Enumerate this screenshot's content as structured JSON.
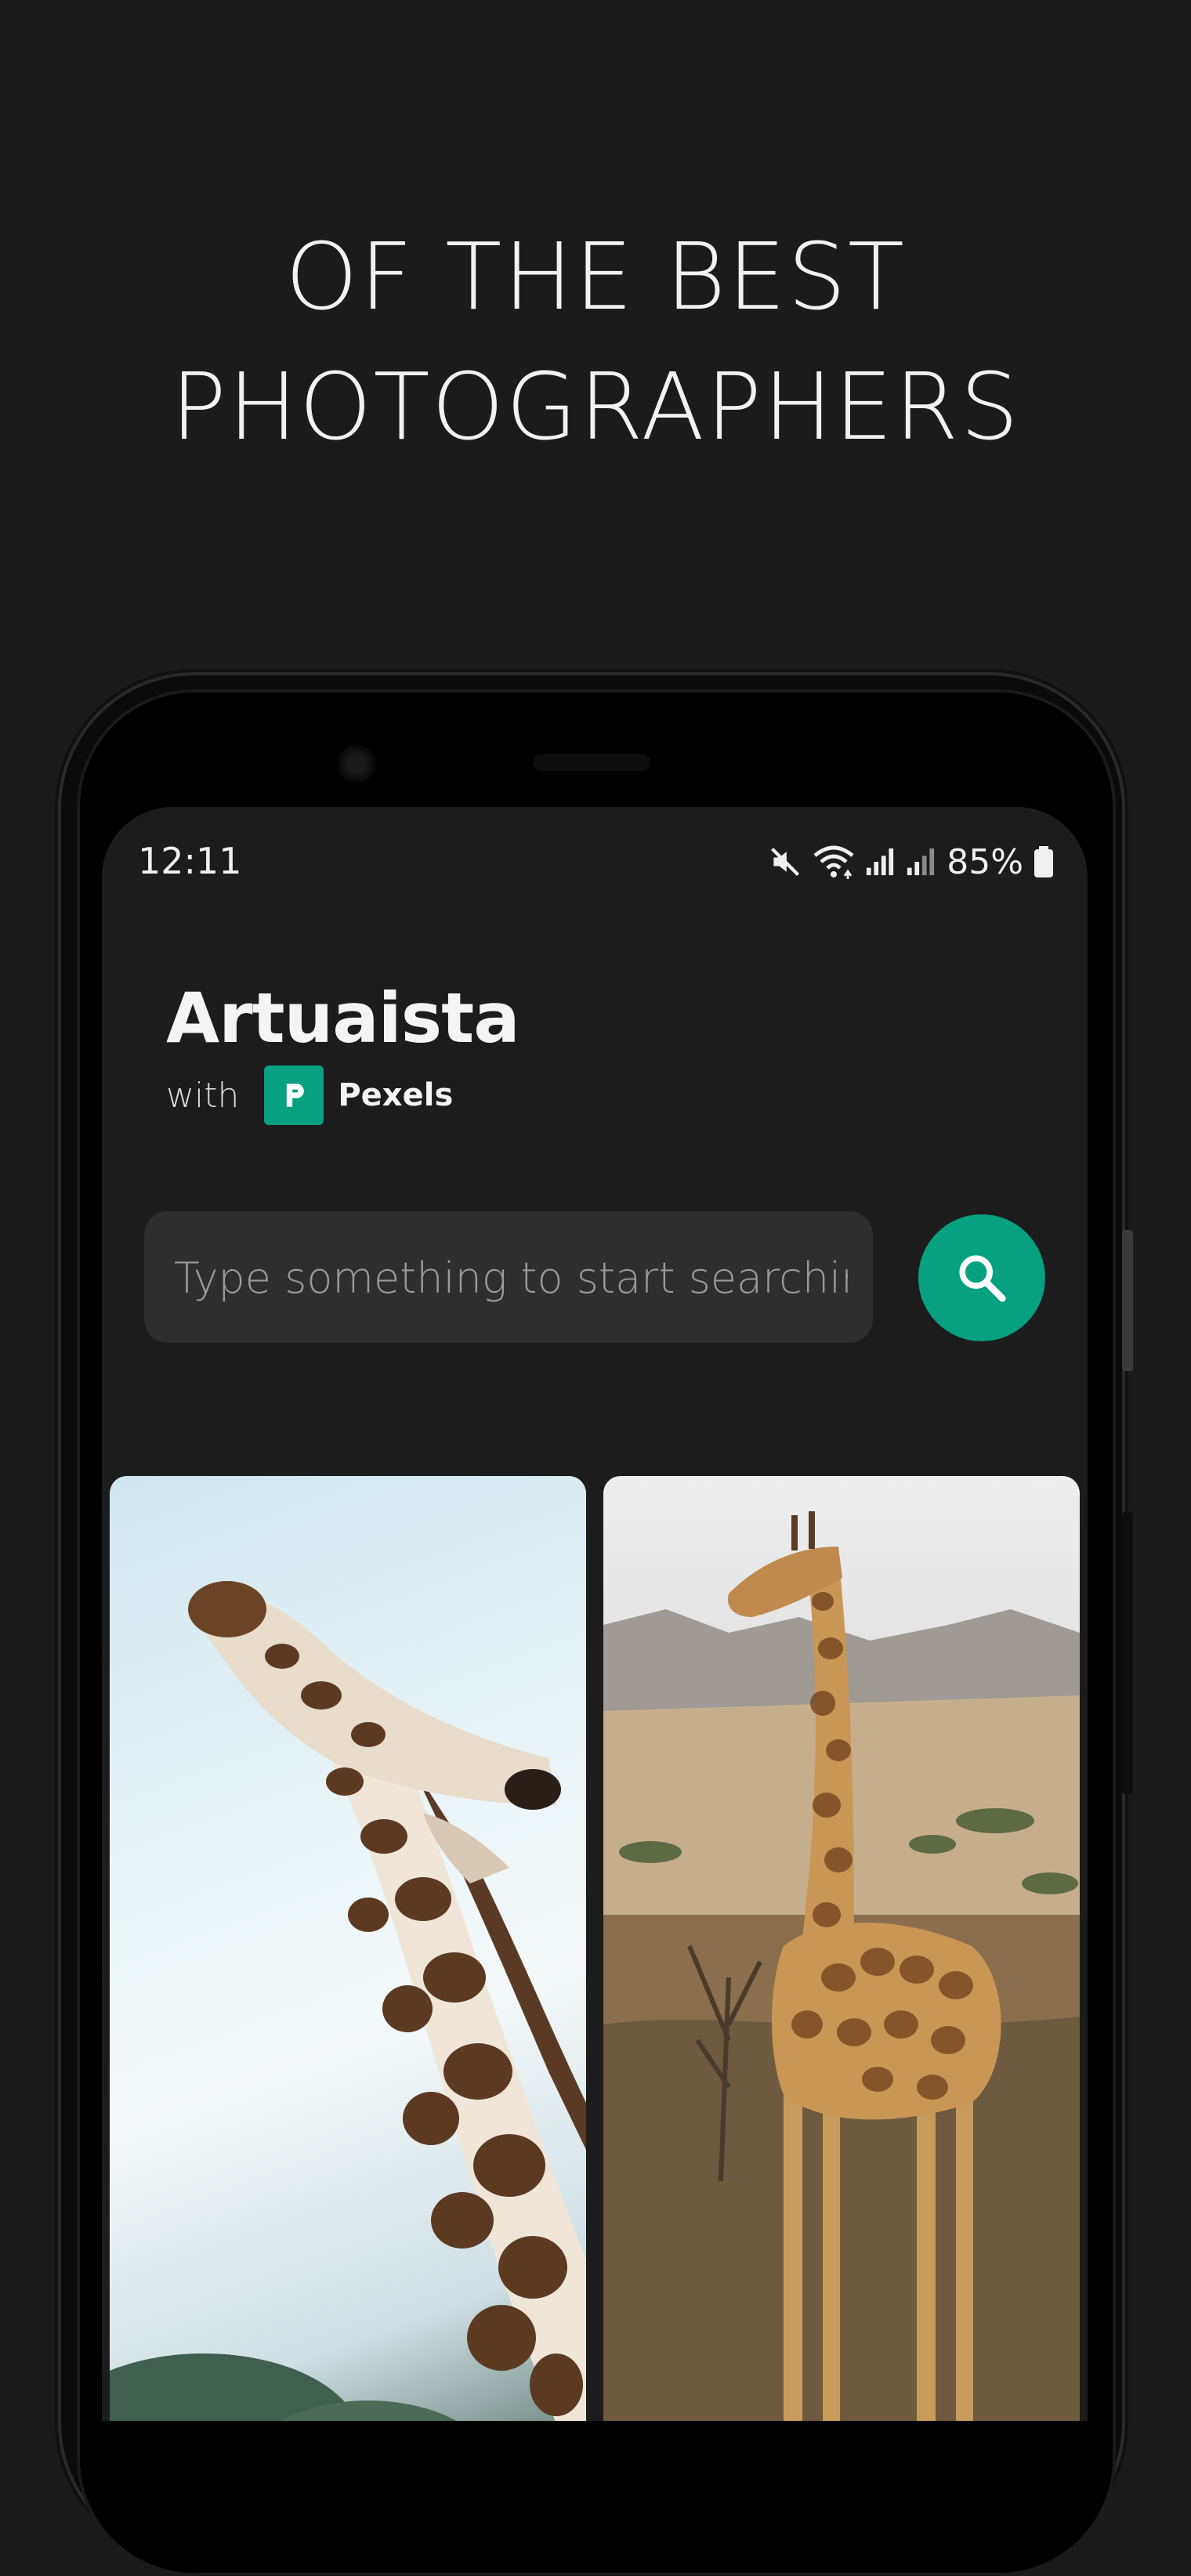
{
  "headline": {
    "line1": "OF THE BEST",
    "line2": "PHOTOGRAPHERS"
  },
  "status_bar": {
    "time": "12:11",
    "battery_percent": "85%",
    "icons": [
      "mute-icon",
      "wifi-icon",
      "signal-icon",
      "signal-icon",
      "battery-icon"
    ]
  },
  "app": {
    "title": "Artuaista",
    "with_label": "with",
    "provider": "Pexels",
    "provider_color": "#07a081"
  },
  "search": {
    "placeholder": "Type something to start searching",
    "value": "",
    "button_icon": "search-icon",
    "button_color": "#07a081"
  },
  "photos": [
    {
      "subject": "giraffe-closeup"
    },
    {
      "subject": "giraffe-savanna"
    }
  ]
}
